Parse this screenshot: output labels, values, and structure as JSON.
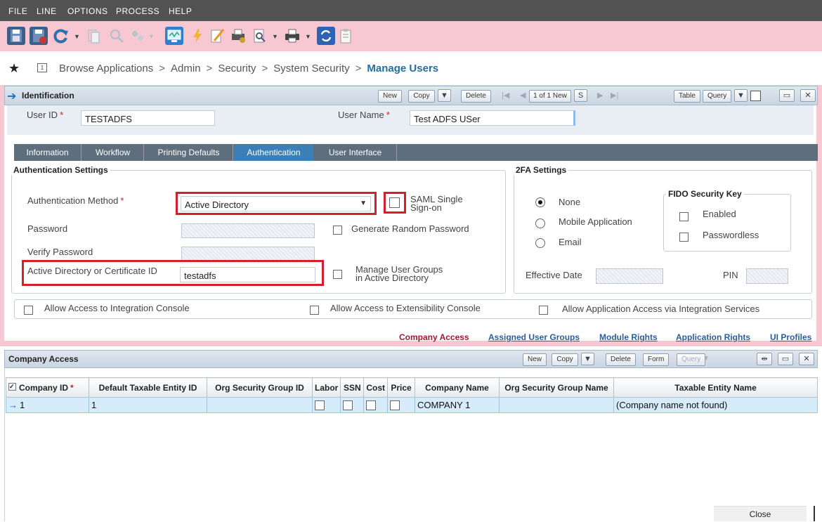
{
  "menu": [
    "FILE",
    "LINE",
    "OPTIONS",
    "PROCESS",
    "HELP"
  ],
  "breadcrumb": {
    "items": [
      "Browse Applications",
      "Admin",
      "Security",
      "System Security"
    ],
    "current": "Manage Users",
    "separator": ">"
  },
  "identification": {
    "title": "Identification",
    "buttons": {
      "new": "New",
      "copy": "Copy",
      "delete": "Delete",
      "table": "Table",
      "query": "Query"
    },
    "record_nav": "1 of 1 New",
    "user_id_label": "User ID",
    "user_id_value": "TESTADFS",
    "user_name_label": "User Name",
    "user_name_value": "Test ADFS USer"
  },
  "tabs": [
    "Information",
    "Workflow",
    "Printing Defaults",
    "Authentication",
    "User Interface"
  ],
  "active_tab": "Authentication",
  "auth": {
    "legend": "Authentication Settings",
    "method_label": "Authentication Method",
    "method_value": "Active Directory",
    "saml_label_1": "SAML Single",
    "saml_label_2": "Sign-on",
    "password_label": "Password",
    "generate_label": "Generate Random Password",
    "verify_label": "Verify Password",
    "adid_label": "Active Directory or Certificate ID",
    "adid_value": "testadfs",
    "manage_groups_1": "Manage User Groups",
    "manage_groups_2": "in Active Directory"
  },
  "twofa": {
    "legend": "2FA Settings",
    "options": [
      "None",
      "Mobile Application",
      "Email"
    ],
    "selected": "None",
    "fido_legend": "FIDO Security Key",
    "fido_enabled": "Enabled",
    "fido_passwordless": "Passwordless",
    "effective_date_label": "Effective Date",
    "pin_label": "PIN"
  },
  "access": {
    "integration_console": "Allow Access to Integration Console",
    "extensibility_console": "Allow Access to Extensibility Console",
    "integration_services": "Allow Application Access via Integration Services"
  },
  "links": [
    "Company Access",
    "Assigned User Groups",
    "Module Rights",
    "Application Rights",
    "UI Profiles"
  ],
  "company_access": {
    "title": "Company Access",
    "buttons": {
      "new": "New",
      "copy": "Copy",
      "delete": "Delete",
      "form": "Form",
      "query": "Query"
    },
    "columns": [
      "Company ID",
      "Default Taxable Entity ID",
      "Org Security Group ID",
      "Labor",
      "SSN",
      "Cost",
      "Price",
      "Company Name",
      "Org Security Group Name",
      "Taxable Entity Name"
    ],
    "rows": [
      {
        "company_id": "1",
        "default_taxable_entity_id": "1",
        "org_security_group_id": "",
        "company_name": "COMPANY 1",
        "org_security_group_name": "",
        "taxable_entity_name": "(Company name not found)"
      }
    ]
  },
  "close_label": "Close",
  "colors": {
    "menubar": "#525252",
    "toolbar": "#f8c8d2",
    "tabbar": "#5e6e7c",
    "active_tab": "#3a7fb8",
    "highlight": "#d3202a",
    "row": "#d7ecfa"
  }
}
